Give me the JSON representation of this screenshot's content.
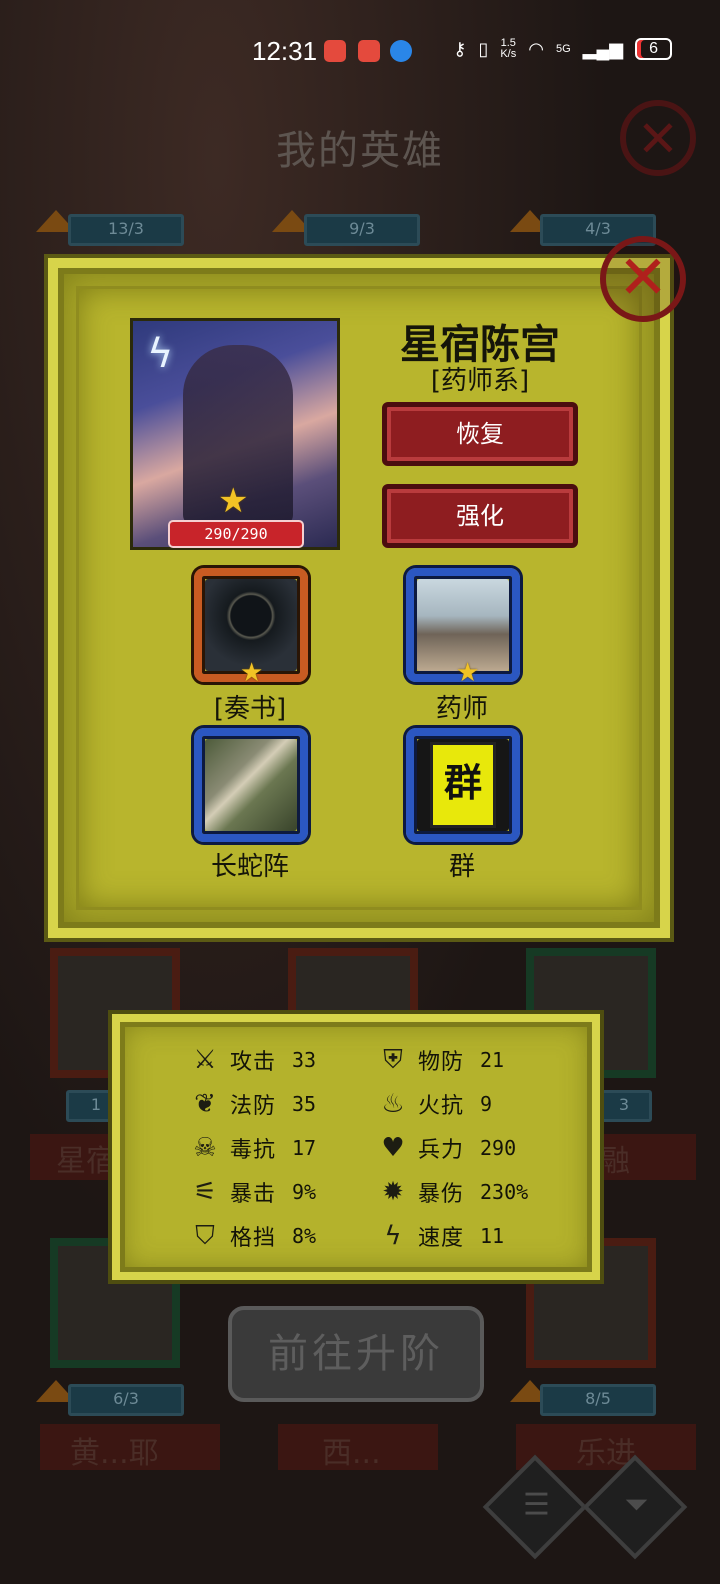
{
  "status_bar": {
    "time": "12:31",
    "net_speed_top": "1.5",
    "net_speed_unit": "K/s",
    "network": "5G",
    "battery": "6"
  },
  "background": {
    "title": "我的英雄",
    "badges": [
      "13/3",
      "9/3",
      "4/3",
      "1",
      "3",
      "6/3",
      "8/5"
    ],
    "names": [
      "星宿",
      "融",
      "黄...耶",
      "西...",
      "乐进"
    ],
    "upgrade_button": "前往升阶"
  },
  "hero": {
    "name": "星宿陈宫",
    "class": "[药师系]",
    "hp": "290/290",
    "restore_label": "恢复",
    "enhance_label": "强化",
    "slots": [
      {
        "label": "[奏书]"
      },
      {
        "label": "药师"
      },
      {
        "label": "长蛇阵"
      },
      {
        "label": "群",
        "icon_text": "群"
      }
    ]
  },
  "stats": [
    {
      "icon": "crossed-swords-icon",
      "label": "攻击",
      "value": "33"
    },
    {
      "icon": "shield-icon",
      "label": "物防",
      "value": "21"
    },
    {
      "icon": "leaf-icon",
      "label": "法防",
      "value": "35"
    },
    {
      "icon": "fire-icon",
      "label": "火抗",
      "value": "9"
    },
    {
      "icon": "skull-icon",
      "label": "毒抗",
      "value": "17"
    },
    {
      "icon": "heart-icon",
      "label": "兵力",
      "value": "290"
    },
    {
      "icon": "claw-icon",
      "label": "暴击",
      "value": "9%"
    },
    {
      "icon": "bomb-icon",
      "label": "暴伤",
      "value": "230%"
    },
    {
      "icon": "block-shield-icon",
      "label": "格挡",
      "value": "8%"
    },
    {
      "icon": "lightning-icon",
      "label": "速度",
      "value": "11"
    }
  ],
  "colors": {
    "panel": "#b8b52d",
    "panel_border": "#d7d44a",
    "button_red": "#8e1d20",
    "slot_orange": "#c85b22",
    "slot_blue": "#2b57c2",
    "star": "#f2c325"
  }
}
